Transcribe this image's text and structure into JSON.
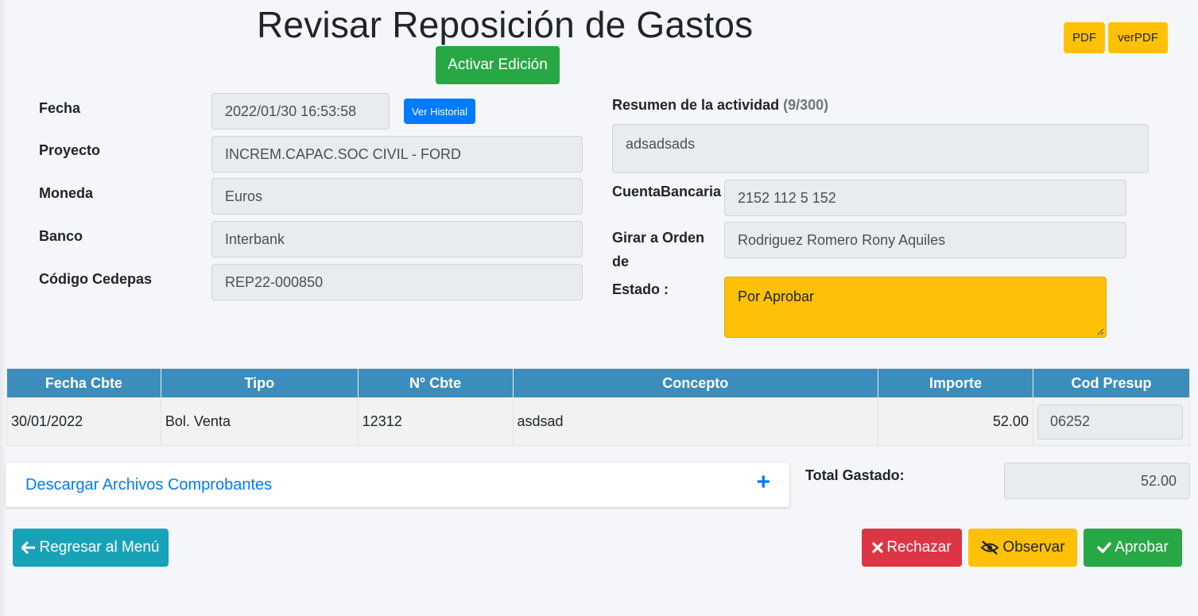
{
  "page": {
    "title": "Revisar Reposición de Gastos",
    "activar_edicion": "Activar Edición",
    "pdf": "PDF",
    "ver_pdf": "verPDF"
  },
  "left_form": {
    "fecha_label": "Fecha",
    "fecha_value": "2022/01/30 16:53:58",
    "ver_historial": "Ver Historial",
    "proyecto_label": "Proyecto",
    "proyecto_value": "INCREM.CAPAC.SOC CIVIL - FORD",
    "moneda_label": "Moneda",
    "moneda_value": "Euros",
    "banco_label": "Banco",
    "banco_value": "Interbank",
    "codigo_label": "Código Cedepas",
    "codigo_value": "REP22-000850"
  },
  "right_form": {
    "resumen_label": "Resumen de la actividad",
    "resumen_counter": "(9/300)",
    "resumen_value": "adsadsads",
    "cuenta_label": "CuentaBancaria",
    "cuenta_value": "2152 112 5 152",
    "girar_label_1": "Girar a Orden",
    "girar_label_2": "de",
    "girar_value": "Rodriguez Romero Rony Aquiles",
    "estado_label": "Estado :",
    "estado_value": "Por Aprobar"
  },
  "table": {
    "headers": [
      "Fecha Cbte",
      "Tipo",
      "N° Cbte",
      "Concepto",
      "Importe",
      "Cod Presup"
    ],
    "rows": [
      {
        "fecha": "30/01/2022",
        "tipo": "Bol. Venta",
        "numero": "12312",
        "concepto": "asdsad",
        "importe": "52.00",
        "cod": "06252"
      }
    ]
  },
  "footer": {
    "descargar": "Descargar Archivos Comprobantes",
    "plus": "+",
    "total_label": "Total Gastado:",
    "total_value": "52.00",
    "regresar": "Regresar al Menú",
    "rechazar": "Rechazar",
    "observar": "Observar",
    "aprobar": "Aprobar"
  },
  "colors": {
    "success": "#28a745",
    "warning": "#ffc107",
    "primary": "#007bff",
    "info": "#17a2b8",
    "danger": "#dc3545",
    "table_header": "#3c8dbc"
  },
  "icons": {
    "regresar": "arrow-left-icon",
    "rechazar": "close-icon",
    "observar": "eye-slash-icon",
    "aprobar": "check-icon",
    "expand": "plus-icon"
  }
}
